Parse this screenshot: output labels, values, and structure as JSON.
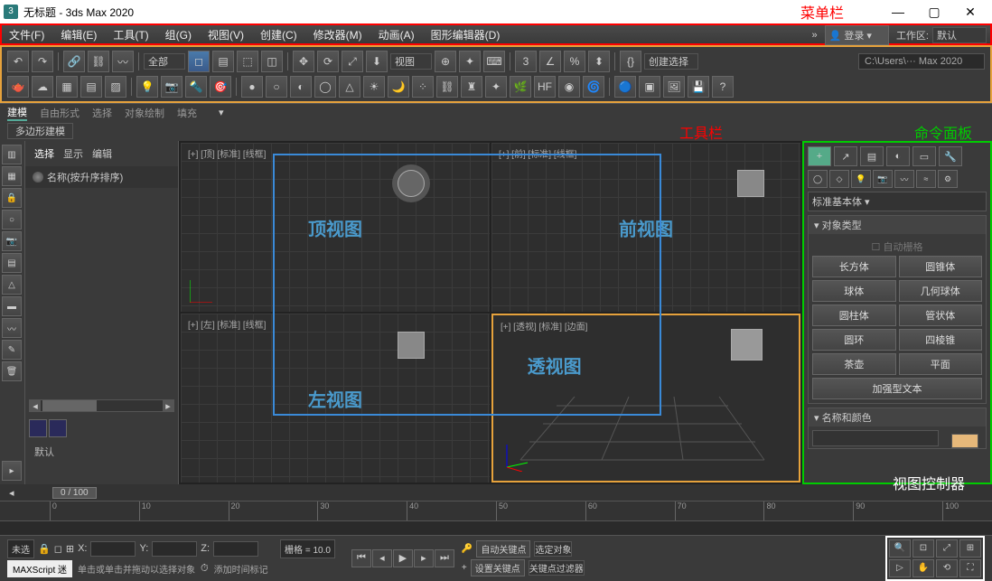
{
  "titlebar": {
    "app_title": "无标题 - 3ds Max 2020",
    "icon_label": "3"
  },
  "annotations": {
    "menubar": "菜单栏",
    "toolbar": "工具栏",
    "command_panel": "命令面板",
    "view_controller": "视图控制器"
  },
  "menubar": {
    "items": [
      "文件(F)",
      "编辑(E)",
      "工具(T)",
      "组(G)",
      "视图(V)",
      "创建(C)",
      "修改器(M)",
      "动画(A)",
      "图形编辑器(D)"
    ]
  },
  "topright": {
    "login": "登录",
    "workspace_label": "工作区:",
    "workspace_value": "默认"
  },
  "toolbar": {
    "filter_all": "全部",
    "view_combo": "视图",
    "create_sel": "创建选择",
    "path": "C:\\Users\\··· Max 2020"
  },
  "sectabs": {
    "items": [
      "建模",
      "自由形式",
      "选择",
      "对象绘制",
      "填充"
    ],
    "active": 0
  },
  "polytab": "多边形建模",
  "scene": {
    "tabs": [
      "选择",
      "显示",
      "编辑"
    ],
    "name_label": "名称(按升序排序)",
    "default": "默认"
  },
  "viewports": {
    "top": {
      "label": "[+] [顶] [标准] [线框]",
      "title": "顶视图"
    },
    "front": {
      "label": "[+] [前] [标准] [线框]",
      "title": "前视图"
    },
    "left": {
      "label": "[+] [左] [标准] [线框]",
      "title": "左视图"
    },
    "persp": {
      "label": "[+] [透视] [标准] [边面]",
      "title": "透视图"
    }
  },
  "command_panel": {
    "primitive_set": "标准基本体",
    "object_type_hdr": "对象类型",
    "autogrid": "自动栅格",
    "primitives": [
      "长方体",
      "圆锥体",
      "球体",
      "几何球体",
      "圆柱体",
      "管状体",
      "圆环",
      "四棱锥",
      "茶壶",
      "平面"
    ],
    "extended_text": "加强型文本",
    "name_color_hdr": "名称和颜色",
    "color": "#e6b87a"
  },
  "timeline": {
    "slider": "0 / 100",
    "ticks": [
      0,
      10,
      20,
      30,
      40,
      50,
      60,
      70,
      80,
      90,
      100
    ]
  },
  "status": {
    "none_selected": "未选",
    "x_label": "X:",
    "y_label": "Y:",
    "z_label": "Z:",
    "grid": "栅格 = 10.0",
    "add_time_tag": "添加时间标记",
    "auto_key": "自动关键点",
    "set_key": "设置关键点",
    "selected_obj": "选定对象",
    "key_filter": "关键点过滤器",
    "maxscript": "MAXScript 迷",
    "hint": "单击或单击并拖动以选择对象"
  }
}
